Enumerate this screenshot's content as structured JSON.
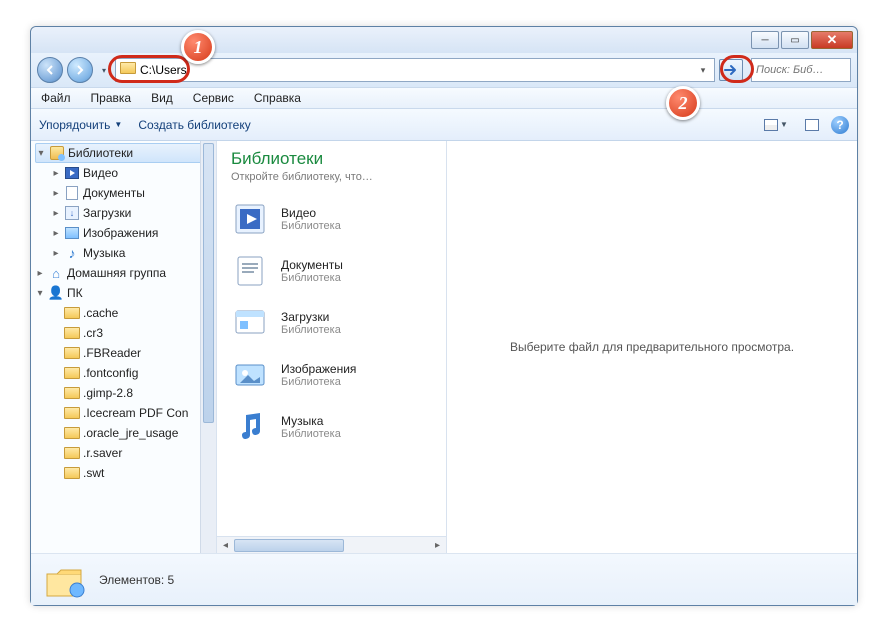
{
  "address_value": "C:\\Users",
  "search_placeholder": "Поиск: Биб…",
  "menu": {
    "file": "Файл",
    "edit": "Правка",
    "view": "Вид",
    "tools": "Сервис",
    "help": "Справка"
  },
  "toolbar": {
    "organize": "Упорядочить",
    "new_library": "Создать библиотеку"
  },
  "tree": {
    "libraries": "Библиотеки",
    "video": "Видео",
    "documents": "Документы",
    "downloads": "Загрузки",
    "pictures": "Изображения",
    "music": "Музыка",
    "homegroup": "Домашняя группа",
    "pc": "ПК",
    "folders": [
      ".cache",
      ".cr3",
      ".FBReader",
      ".fontconfig",
      ".gimp-2.8",
      ".Icecream PDF Con",
      ".oracle_jre_usage",
      ".r.saver",
      ".swt"
    ]
  },
  "content": {
    "title": "Библиотеки",
    "subtitle": "Откройте библиотеку, что…",
    "type_label": "Библиотека",
    "items": {
      "video": "Видео",
      "documents": "Документы",
      "downloads": "Загрузки",
      "pictures": "Изображения",
      "music": "Музыка"
    }
  },
  "preview_text": "Выберите файл для предварительного просмотра.",
  "status_text": "Элементов: 5",
  "callouts": {
    "c1": "1",
    "c2": "2"
  }
}
